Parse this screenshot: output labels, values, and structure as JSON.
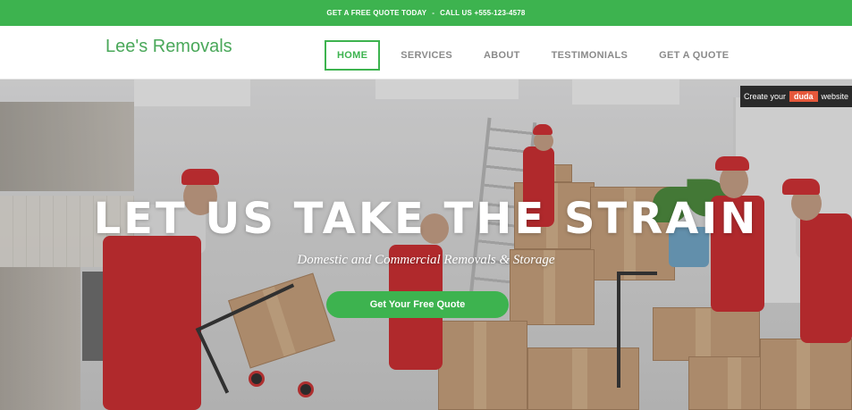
{
  "topbar": {
    "quote": "GET A FREE QUOTE TODAY",
    "separator": "-",
    "phone": "CALL US +555-123-4578"
  },
  "header": {
    "brand": "Lee's Removals",
    "nav": [
      "HOME",
      "SERVICES",
      "ABOUT",
      "TESTIMONIALS",
      "GET A QUOTE"
    ],
    "active_index": 0
  },
  "hero": {
    "title": "LET US TAKE THE STRAIN",
    "subtitle": "Domestic and Commercial Removals & Storage",
    "cta": "Get Your Free Quote"
  },
  "duda_badge": {
    "prefix": "Create your",
    "logo": "duda",
    "suffix": "website"
  },
  "colors": {
    "accent": "#3db34f",
    "brand_text": "#4aa85a",
    "nav_text": "#8a8a8a",
    "badge_bg": "#2a2a2a",
    "duda_logo": "#e5583b"
  }
}
